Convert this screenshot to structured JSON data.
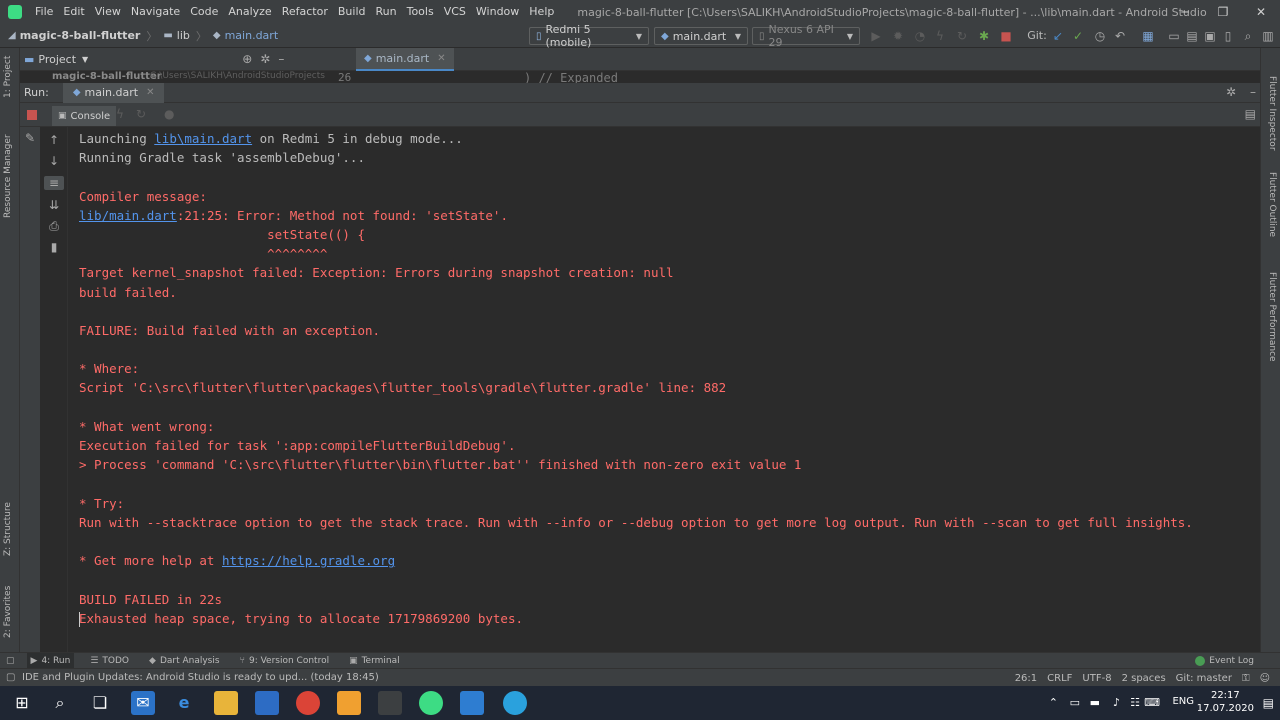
{
  "window": {
    "title": "magic-8-ball-flutter [C:\\Users\\SALIKH\\AndroidStudioProjects\\magic-8-ball-flutter] - ...\\lib\\main.dart - Android Studio",
    "controls": [
      "─",
      "❐",
      "✕"
    ]
  },
  "menu": [
    "File",
    "Edit",
    "View",
    "Navigate",
    "Code",
    "Analyze",
    "Refactor",
    "Build",
    "Run",
    "Tools",
    "VCS",
    "Window",
    "Help"
  ],
  "navbar": {
    "project": "magic-8-ball-flutter",
    "folder": "lib",
    "file": "main.dart",
    "device_combo": "Redmi 5 (mobile)",
    "run_config_combo": "main.dart",
    "avd_combo": "Nexus 6 API 29",
    "git_label": "Git:"
  },
  "project_panel": {
    "label": "Project",
    "editor_tab": "main.dart",
    "peek_left": "magic-8-ball-flutter",
    "peek_path": "C:\\Users\\SALIKH\\AndroidStudioProjects",
    "peek_line": "26",
    "peek_code": ")  // Expanded"
  },
  "left_stripe": [
    "1: Project",
    "Resource Manager",
    "Z: Structure",
    "2: Favorites"
  ],
  "right_stripe": [
    "Flutter Inspector",
    "Flutter Outline",
    "Flutter Performance"
  ],
  "run_window": {
    "label": "Run:",
    "tab": "main.dart",
    "console_tab": "Console"
  },
  "console": {
    "lines": [
      {
        "type": "n",
        "parts": [
          {
            "t": "Launching "
          },
          {
            "t": "lib\\main.dart",
            "link": true
          },
          {
            "t": " on Redmi 5 in debug mode..."
          }
        ]
      },
      {
        "type": "n",
        "parts": [
          {
            "t": "Running Gradle task 'assembleDebug'..."
          }
        ]
      },
      {
        "type": "n",
        "parts": [
          {
            "t": ""
          }
        ]
      },
      {
        "type": "e",
        "parts": [
          {
            "t": "Compiler message:"
          }
        ]
      },
      {
        "type": "e",
        "parts": [
          {
            "t": "lib/main.dart",
            "link": true
          },
          {
            "t": ":21:25: Error: Method not found: 'setState'."
          }
        ]
      },
      {
        "type": "e",
        "parts": [
          {
            "t": "                         setState(() {"
          }
        ]
      },
      {
        "type": "e",
        "parts": [
          {
            "t": "                         ^^^^^^^^"
          }
        ]
      },
      {
        "type": "e",
        "parts": [
          {
            "t": "Target kernel_snapshot failed: Exception: Errors during snapshot creation: null"
          }
        ]
      },
      {
        "type": "e",
        "parts": [
          {
            "t": "build failed."
          }
        ]
      },
      {
        "type": "e",
        "parts": [
          {
            "t": ""
          }
        ]
      },
      {
        "type": "e",
        "parts": [
          {
            "t": "FAILURE: Build failed with an exception."
          }
        ]
      },
      {
        "type": "e",
        "parts": [
          {
            "t": ""
          }
        ]
      },
      {
        "type": "e",
        "parts": [
          {
            "t": "* Where:"
          }
        ]
      },
      {
        "type": "e",
        "parts": [
          {
            "t": "Script 'C:\\src\\flutter\\flutter\\packages\\flutter_tools\\gradle\\flutter.gradle' line: 882"
          }
        ]
      },
      {
        "type": "e",
        "parts": [
          {
            "t": ""
          }
        ]
      },
      {
        "type": "e",
        "parts": [
          {
            "t": "* What went wrong:"
          }
        ]
      },
      {
        "type": "e",
        "parts": [
          {
            "t": "Execution failed for task ':app:compileFlutterBuildDebug'."
          }
        ]
      },
      {
        "type": "e",
        "parts": [
          {
            "t": "> Process 'command 'C:\\src\\flutter\\flutter\\bin\\flutter.bat'' finished with non-zero exit value 1"
          }
        ]
      },
      {
        "type": "e",
        "parts": [
          {
            "t": ""
          }
        ]
      },
      {
        "type": "e",
        "parts": [
          {
            "t": "* Try:"
          }
        ]
      },
      {
        "type": "e",
        "parts": [
          {
            "t": "Run with --stacktrace option to get the stack trace. Run with --info or --debug option to get more log output. Run with --scan to get full insights."
          }
        ]
      },
      {
        "type": "e",
        "parts": [
          {
            "t": ""
          }
        ]
      },
      {
        "type": "e",
        "parts": [
          {
            "t": "* Get more help at "
          },
          {
            "t": "https://help.gradle.org",
            "link": true
          }
        ]
      },
      {
        "type": "e",
        "parts": [
          {
            "t": ""
          }
        ]
      },
      {
        "type": "e",
        "parts": [
          {
            "t": "BUILD FAILED in 22s"
          }
        ]
      },
      {
        "type": "e",
        "caret": true,
        "parts": [
          {
            "t": "Exhausted heap space, trying to allocate 17179869200 bytes."
          }
        ]
      }
    ]
  },
  "bottom_tabs": [
    {
      "label": "4: Run",
      "icon": "▶",
      "active": true
    },
    {
      "label": "TODO",
      "icon": "☰",
      "active": false
    },
    {
      "label": "Dart Analysis",
      "icon": "◆",
      "active": false
    },
    {
      "label": "9: Version Control",
      "icon": "⑂",
      "active": false
    },
    {
      "label": "Terminal",
      "icon": "▣",
      "active": false
    }
  ],
  "event_log": "Event Log",
  "status": {
    "message": "IDE and Plugin Updates: Android Studio is ready to upd... (today 18:45)",
    "position": "26:1",
    "line_sep": "CRLF",
    "encoding": "UTF-8",
    "indent": "2 spaces",
    "git_branch": "Git: master"
  },
  "taskbar": {
    "lang": "ENG",
    "time": "22:17",
    "date": "17.07.2020"
  },
  "colors": {
    "error_text": "#ff6b68",
    "link": "#5394ec",
    "normal_text": "#bbbbbb",
    "stop": "#c75450"
  }
}
